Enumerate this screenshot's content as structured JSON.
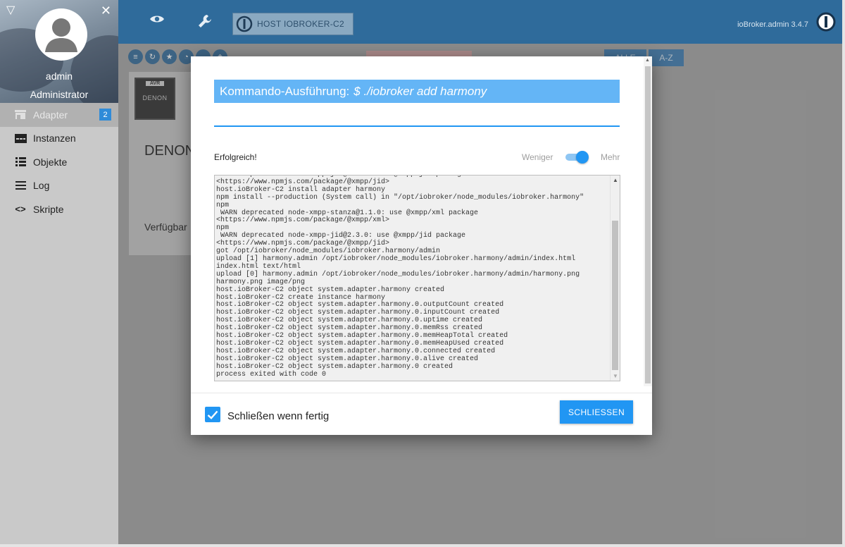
{
  "sidebar": {
    "user_name": "admin",
    "user_role": "Administrator",
    "items": [
      {
        "label": "Adapter",
        "badge": "2",
        "icon": "store-icon"
      },
      {
        "label": "Instanzen",
        "icon": "instances-icon"
      },
      {
        "label": "Objekte",
        "icon": "list-icon"
      },
      {
        "label": "Log",
        "icon": "lines-icon"
      },
      {
        "label": "Skripte",
        "icon": "code-icon"
      }
    ]
  },
  "topbar": {
    "host_label": "HOST IOBROKER-C2",
    "version": "ioBroker.admin 3.4.7"
  },
  "adapters_page": {
    "filter_alle": "ALLE",
    "filter_az": "A-Z",
    "card_logo_badge": "AVR",
    "card_logo_brand": "DENON",
    "card_title": "DENON",
    "card_available": "Verfügbar"
  },
  "dialog": {
    "title_prefix": "Kommando-Ausführung:",
    "command": "$ ./iobroker add harmony",
    "status": "Erfolgreich!",
    "toggle_less": "Weniger",
    "toggle_more": "Mehr",
    "output_lines": [
      " WARN deprecated node-xmpp-jid@2.3.0: use @xmpp/jid package",
      "<https://www.npmjs.com/package/@xmpp/jid>",
      "host.ioBroker-C2 install adapter harmony",
      "npm install --production (System call) in \"/opt/iobroker/node_modules/iobroker.harmony\"",
      "npm",
      " WARN deprecated node-xmpp-stanza@1.1.0: use @xmpp/xml package",
      "<https://www.npmjs.com/package/@xmpp/xml>",
      "npm",
      " WARN deprecated node-xmpp-jid@2.3.0: use @xmpp/jid package",
      "<https://www.npmjs.com/package/@xmpp/jid>",
      "got /opt/iobroker/node_modules/iobroker.harmony/admin",
      "upload [1] harmony.admin /opt/iobroker/node_modules/iobroker.harmony/admin/index.html",
      "index.html text/html",
      "upload [0] harmony.admin /opt/iobroker/node_modules/iobroker.harmony/admin/harmony.png",
      "harmony.png image/png",
      "host.ioBroker-C2 object system.adapter.harmony created",
      "host.ioBroker-C2 create instance harmony",
      "host.ioBroker-C2 object system.adapter.harmony.0.outputCount created",
      "host.ioBroker-C2 object system.adapter.harmony.0.inputCount created",
      "host.ioBroker-C2 object system.adapter.harmony.0.uptime created",
      "host.ioBroker-C2 object system.adapter.harmony.0.memRss created",
      "host.ioBroker-C2 object system.adapter.harmony.0.memHeapTotal created",
      "host.ioBroker-C2 object system.adapter.harmony.0.memHeapUsed created",
      "host.ioBroker-C2 object system.adapter.harmony.0.connected created",
      "host.ioBroker-C2 object system.adapter.harmony.0.alive created",
      "host.ioBroker-C2 object system.adapter.harmony.0 created",
      "process exited with code 0"
    ],
    "checkbox_label": "Schließen wenn fertig",
    "checkbox_checked": true,
    "close_button": "SCHLIESSEN"
  },
  "colors": {
    "primary": "#2196f3",
    "title_bar": "#64b5f6",
    "topbar": "#2f6b9b"
  }
}
